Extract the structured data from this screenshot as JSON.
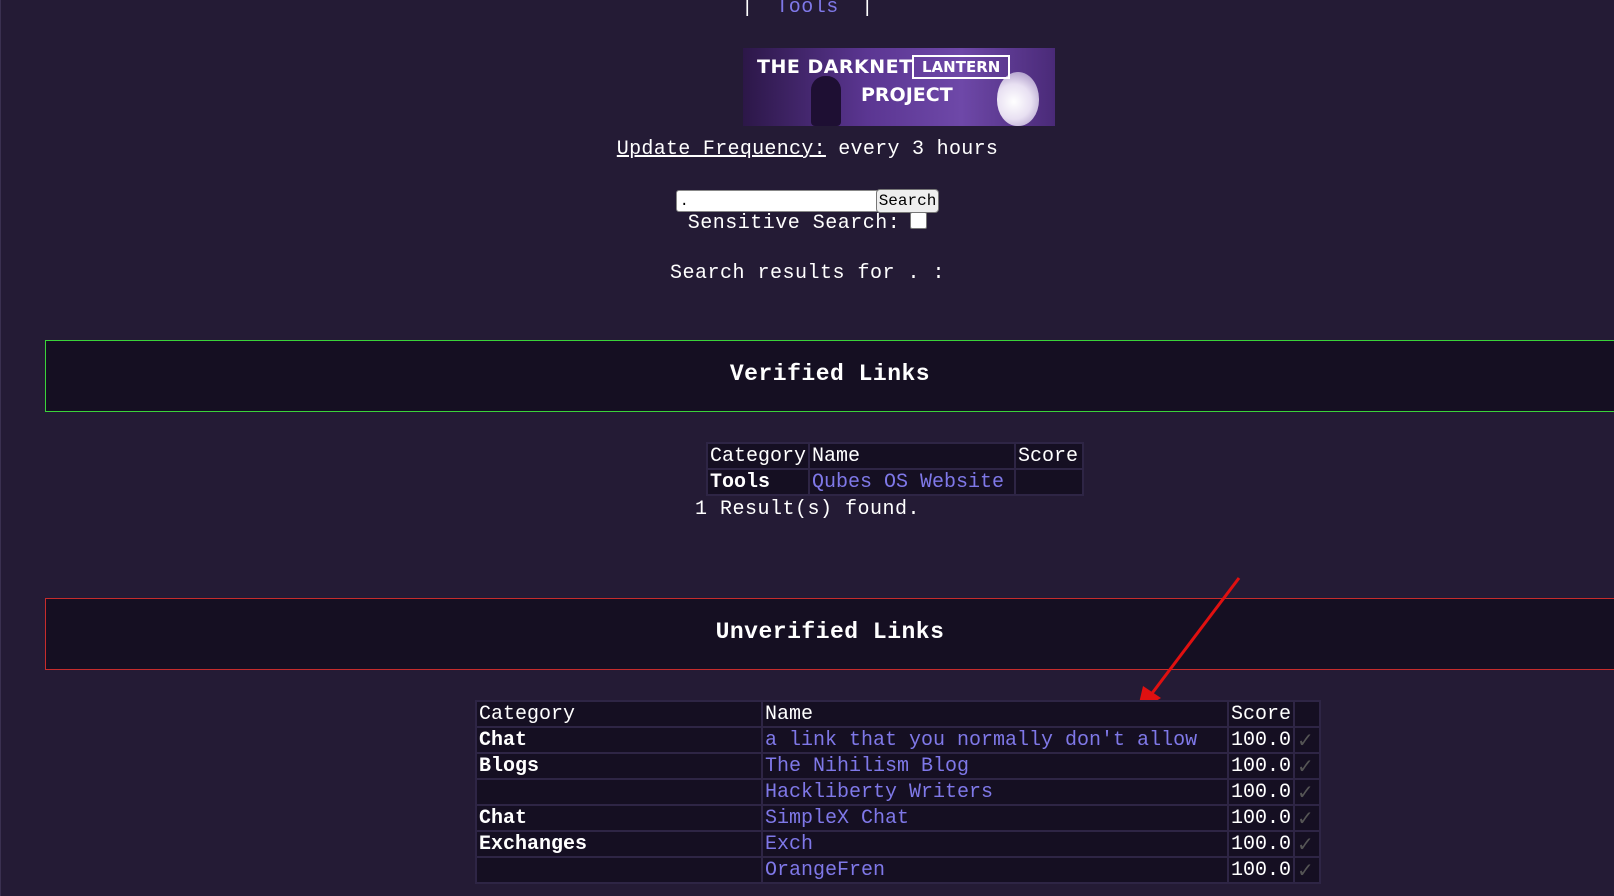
{
  "nav": {
    "left_sep": "|",
    "tools_label": "Tools",
    "right_sep": "|"
  },
  "banner": {
    "line1": "THE DARKNET",
    "boxed": "LANTERN",
    "line2": "PROJECT"
  },
  "update": {
    "label": "Update Frequency:",
    "value": "every 3 hours"
  },
  "search": {
    "value": ".",
    "button_label": "Search",
    "sensitive_label": "Sensitive Search:"
  },
  "results_heading": "Search results for . :",
  "verified": {
    "title": "Verified Links",
    "headers": [
      "Category",
      "Name",
      "Score"
    ],
    "rows": [
      {
        "category": "Tools",
        "name": "Qubes OS Website",
        "score": ""
      }
    ],
    "count_text": "1 Result(s) found."
  },
  "unverified": {
    "title": "Unverified Links",
    "headers": [
      "Category",
      "Name",
      "Score",
      ""
    ],
    "rows": [
      {
        "category": "Chat",
        "name": "a link that you normally don't allow",
        "score": "100.0",
        "check": "✓"
      },
      {
        "category": "Blogs",
        "name": "The Nihilism Blog",
        "score": "100.0",
        "check": "✓"
      },
      {
        "category": "",
        "name": "Hackliberty Writers",
        "score": "100.0",
        "check": "✓"
      },
      {
        "category": "Chat",
        "name": "SimpleX Chat",
        "score": "100.0",
        "check": "✓"
      },
      {
        "category": "Exchanges",
        "name": "Exch",
        "score": "100.0",
        "check": "✓"
      },
      {
        "category": "",
        "name": "OrangeFren",
        "score": "100.0",
        "check": "✓"
      }
    ]
  },
  "annotation_color": "#e01010"
}
